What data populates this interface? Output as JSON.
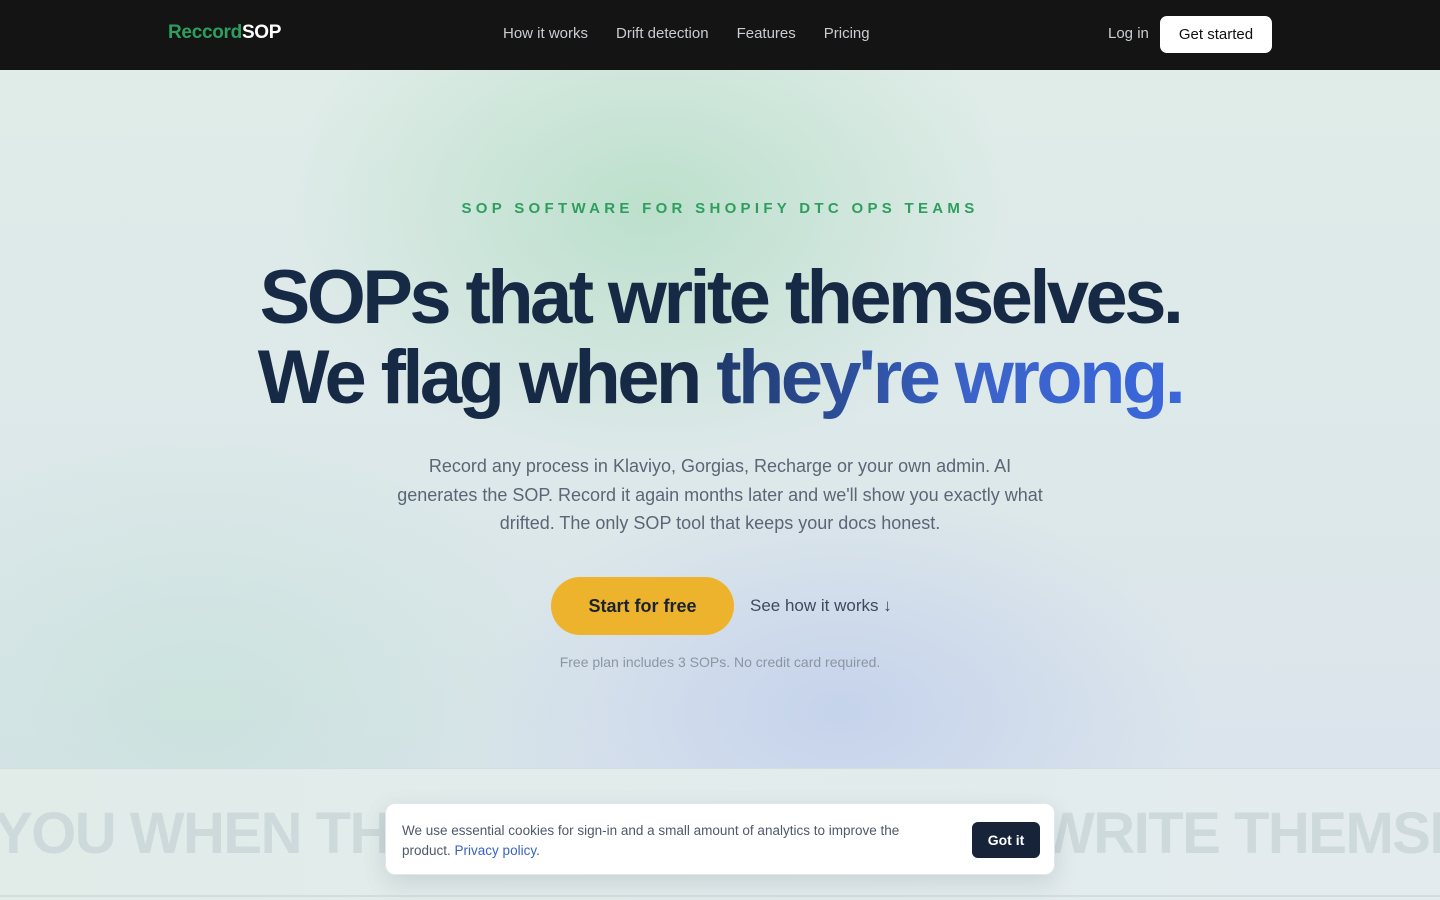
{
  "nav": {
    "logo_part1": "Reccord",
    "logo_part2": "SOP",
    "links": [
      "How it works",
      "Drift detection",
      "Features",
      "Pricing"
    ],
    "login": "Log in",
    "cta": "Get started"
  },
  "hero": {
    "eyebrow": "SOP SOFTWARE FOR SHOPIFY DTC OPS TEAMS",
    "headline_line1": "SOPs that write themselves.",
    "headline_line2_plain": "We flag when ",
    "headline_line2_accent": "they're wrong.",
    "subtext": "Record any process in Klaviyo, Gorgias, Recharge or your own admin. AI generates the SOP. Record it again months later and we'll show you exactly what drifted. The only SOP tool that keeps your docs honest.",
    "primary_cta": "Start for free",
    "secondary_cta": "See how it works ↓",
    "note": "Free plan includes 3 SOPs. No credit card required."
  },
  "marquee": {
    "left_text": "YOU WHEN THEY",
    "right_text": "WRITE THEMSELV"
  },
  "cookie": {
    "text": "We use essential cookies for sign-in and a small amount of analytics to improve the product.",
    "link": "Privacy policy",
    "link_suffix": ".",
    "button": "Got it"
  },
  "colors": {
    "brand_green": "#2e9e5e",
    "cta_yellow": "#edb32c",
    "accent_blue": "#3a66db",
    "navy": "#172a45"
  }
}
